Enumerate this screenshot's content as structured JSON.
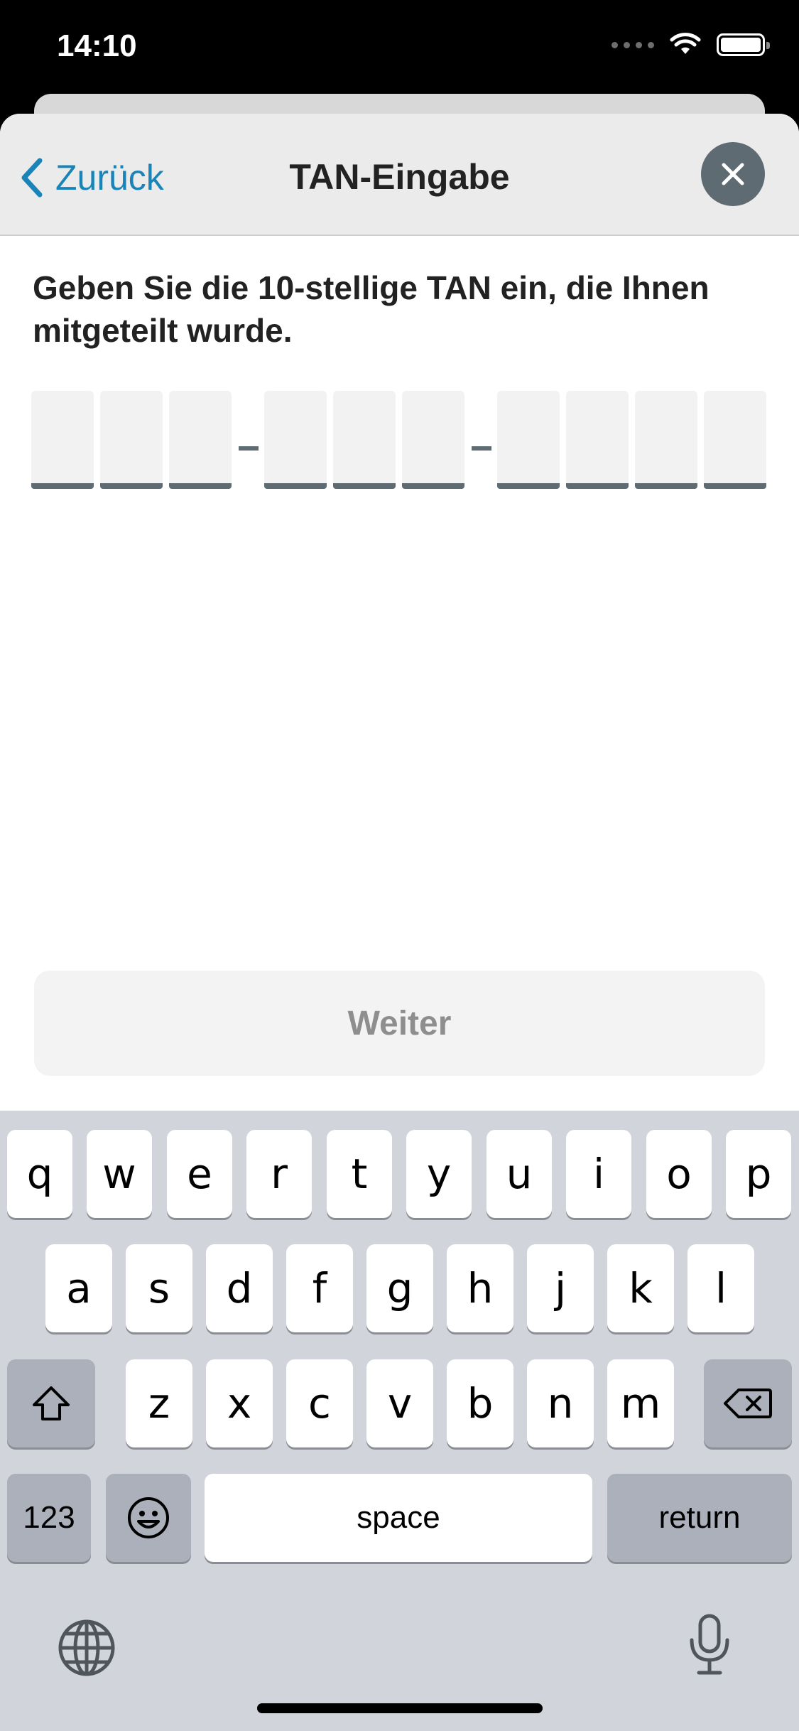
{
  "status_bar": {
    "time": "14:10"
  },
  "nav": {
    "back_label": "Zurück",
    "title": "TAN-Eingabe"
  },
  "instruction": "Geben Sie die 10-stellige TAN ein, die Ihnen mitgeteilt wurde.",
  "tan": {
    "groups": [
      3,
      3,
      4
    ],
    "separator": "-"
  },
  "next_button": "Weiter",
  "keyboard": {
    "row1": [
      "q",
      "w",
      "e",
      "r",
      "t",
      "y",
      "u",
      "i",
      "o",
      "p"
    ],
    "row2": [
      "a",
      "s",
      "d",
      "f",
      "g",
      "h",
      "j",
      "k",
      "l"
    ],
    "row3": [
      "z",
      "x",
      "c",
      "v",
      "b",
      "n",
      "m"
    ],
    "numbers_label": "123",
    "space_label": "space",
    "return_label": "return"
  },
  "colors": {
    "accent": "#1a84b8",
    "tan_underline": "#5f6b73",
    "close_bg": "#5f6b73"
  }
}
